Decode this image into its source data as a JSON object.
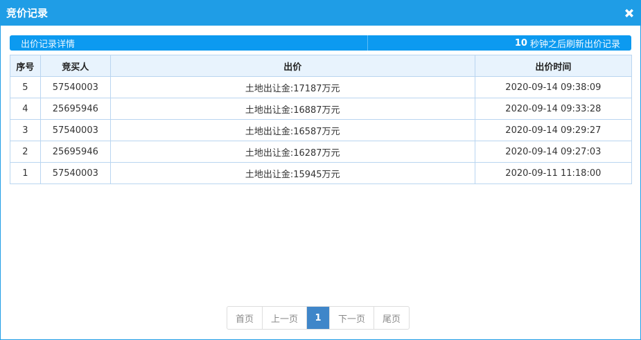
{
  "dialog": {
    "title": "竞价记录"
  },
  "infobar": {
    "left_label": "出价记录详情",
    "countdown": "10",
    "refresh_text": "秒钟之后刷新出价记录"
  },
  "table": {
    "headers": [
      "序号",
      "竞买人",
      "出价",
      "出价时间"
    ],
    "rows": [
      {
        "no": "5",
        "bidder": "57540003",
        "price": "土地出让金:17187万元",
        "time": "2020-09-14 09:38:09"
      },
      {
        "no": "4",
        "bidder": "25695946",
        "price": "土地出让金:16887万元",
        "time": "2020-09-14 09:33:28"
      },
      {
        "no": "3",
        "bidder": "57540003",
        "price": "土地出让金:16587万元",
        "time": "2020-09-14 09:29:27"
      },
      {
        "no": "2",
        "bidder": "25695946",
        "price": "土地出让金:16287万元",
        "time": "2020-09-14 09:27:03"
      },
      {
        "no": "1",
        "bidder": "57540003",
        "price": "土地出让金:15945万元",
        "time": "2020-09-11 11:18:00"
      }
    ]
  },
  "pager": {
    "first": "首页",
    "prev": "上一页",
    "current": "1",
    "next": "下一页",
    "last": "尾页"
  },
  "colors": {
    "titlebar": "#1f9de6",
    "infobar": "#0c9af0",
    "active_page": "#3f86c9"
  },
  "icons": {
    "close": "close-icon"
  }
}
